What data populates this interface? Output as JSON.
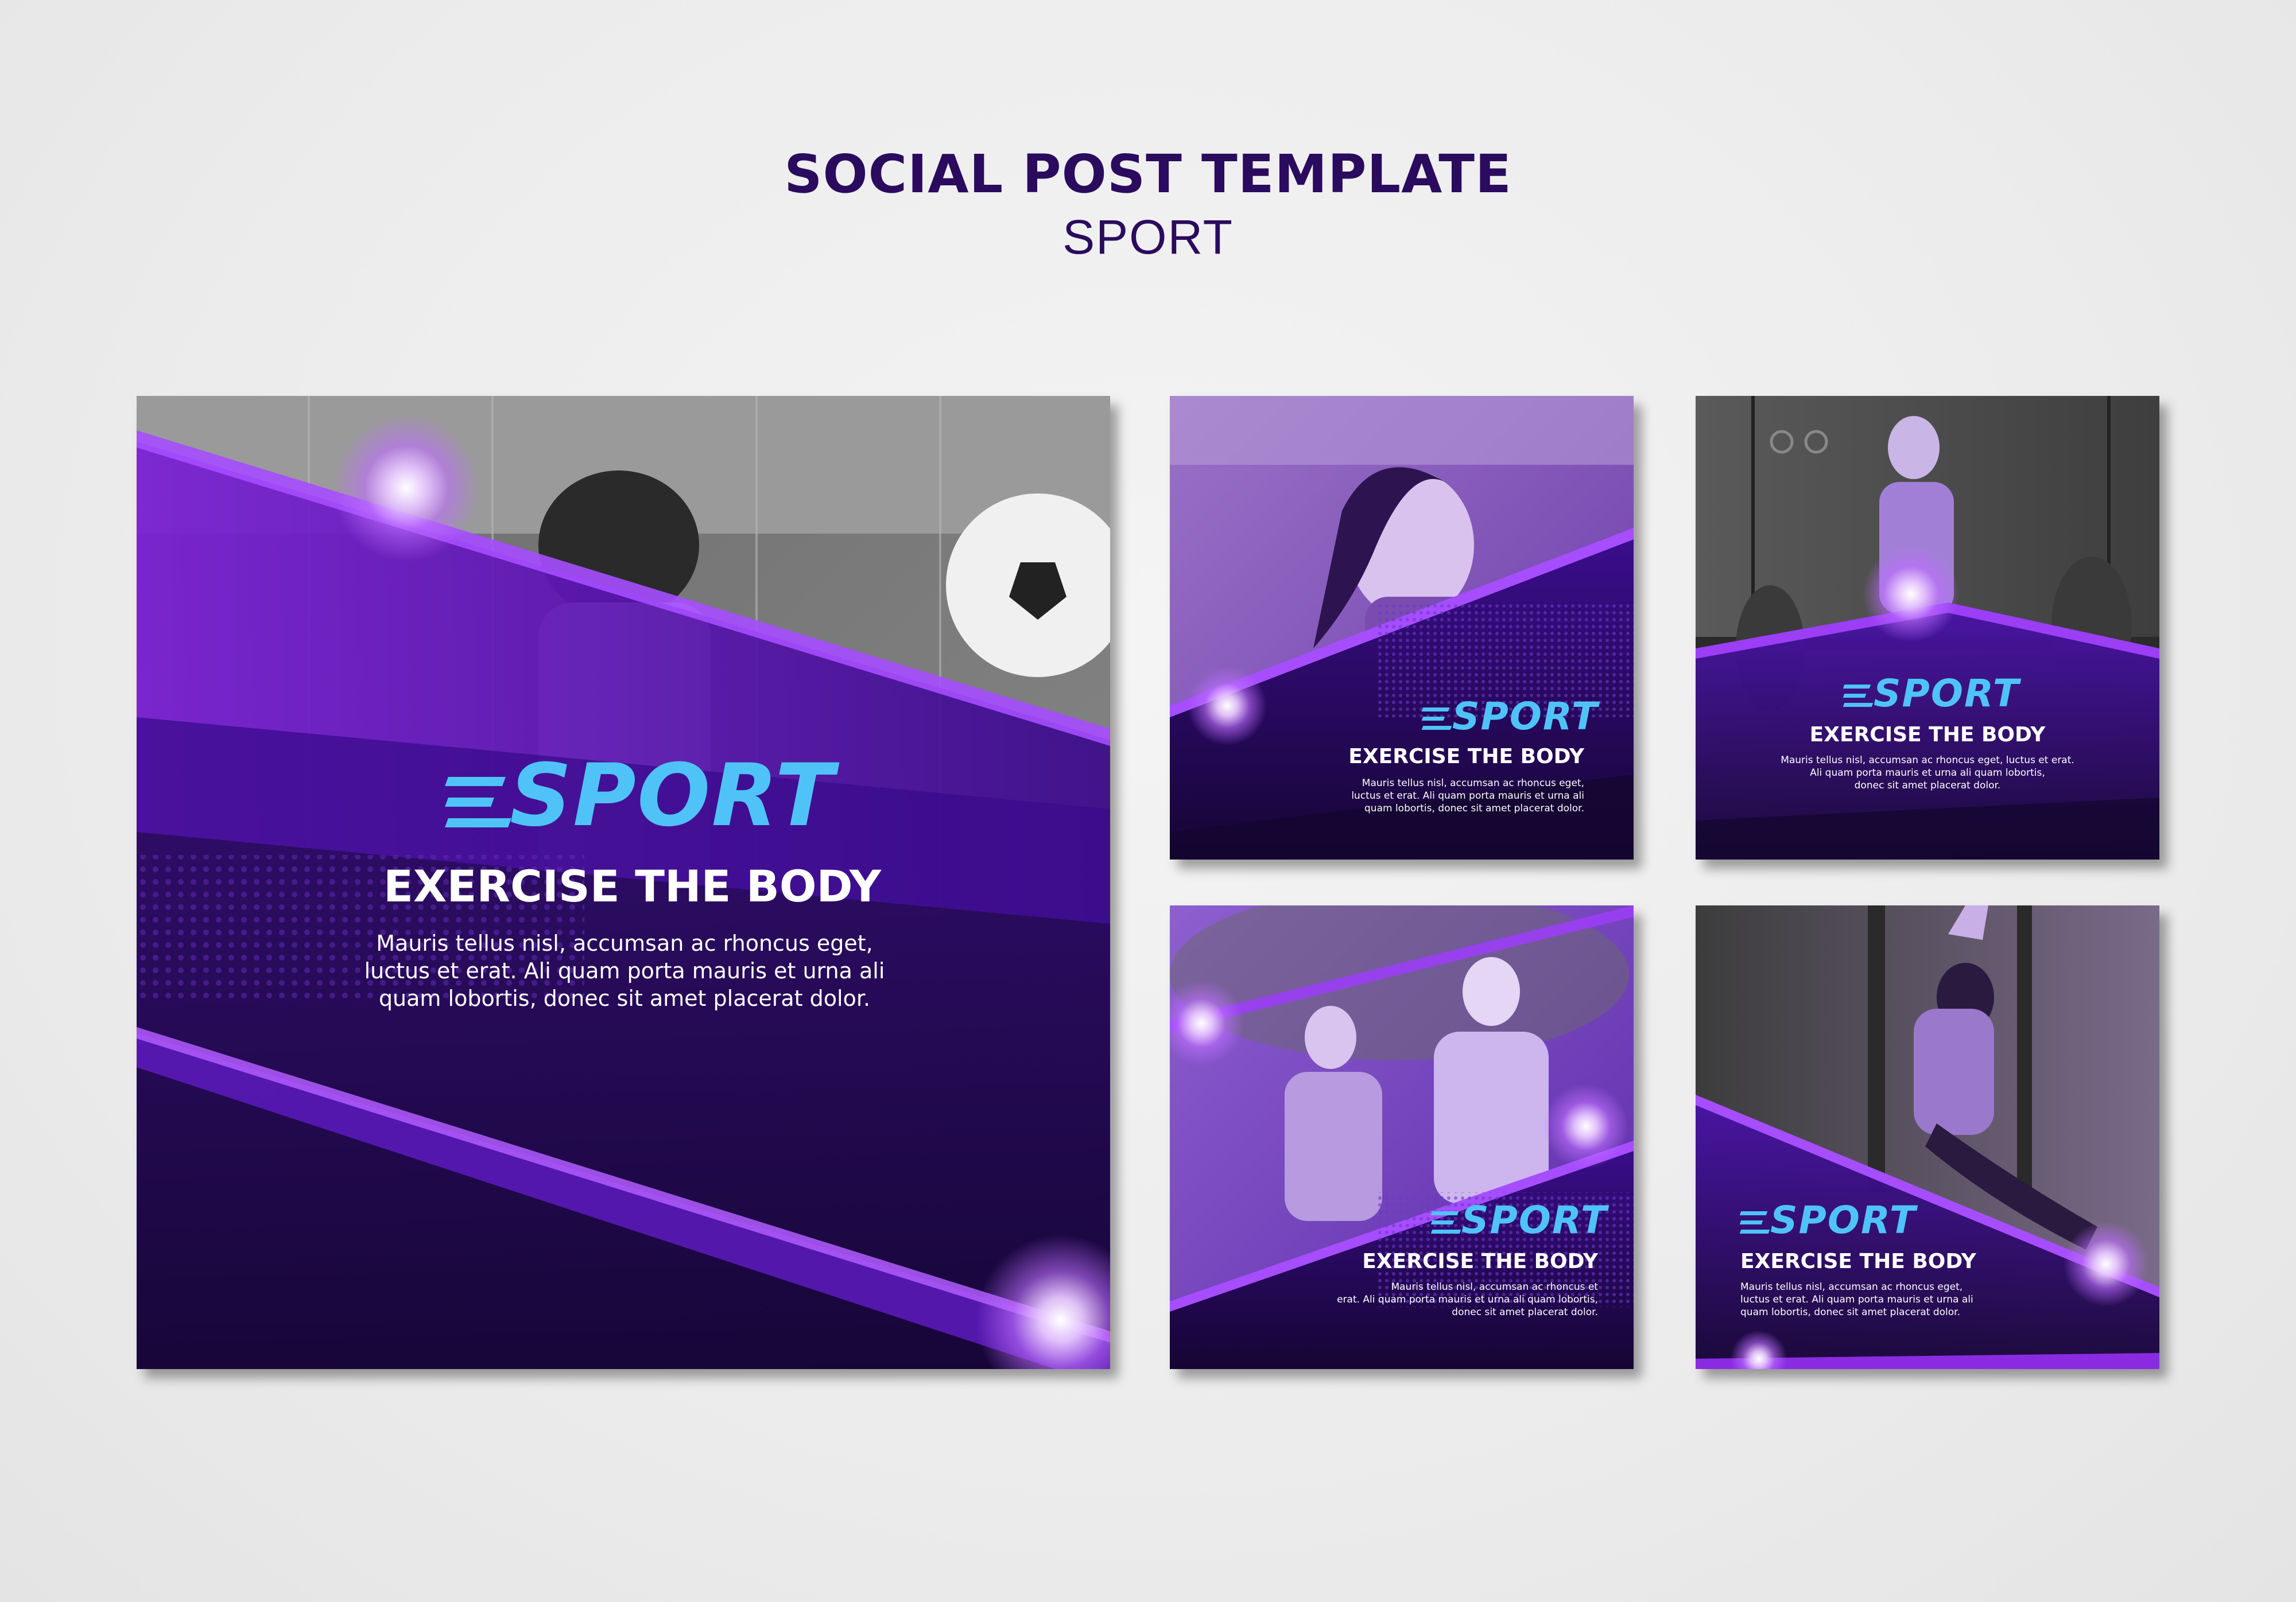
{
  "header": {
    "title": "SOCIAL POST TEMPLATE",
    "subtitle": "SPORT"
  },
  "posts": [
    {
      "logo": "SPORT",
      "headline": "EXERCISE THE BODY",
      "body_lines": [
        "Mauris tellus nisl, accumsan ac rhoncus eget,",
        "luctus et erat. Ali quam porta mauris et urna ali",
        "quam lobortis, donec sit amet placerat dolor."
      ],
      "photo": "soccer-player-photo"
    },
    {
      "logo": "SPORT",
      "headline": "EXERCISE THE BODY",
      "body_lines": [
        "Mauris tellus nisl, accumsan ac rhoncus eget,",
        "luctus et erat. Ali quam porta mauris et urna ali",
        "quam lobortis, donec sit amet placerat dolor."
      ],
      "photo": "runner-woman-photo"
    },
    {
      "logo": "SPORT",
      "headline": "EXERCISE THE BODY",
      "body_lines": [
        "Mauris tellus nisl, accumsan ac rhoncus eget, luctus et erat.",
        "Ali quam porta mauris et urna ali quam lobortis,",
        "donec sit amet placerat dolor."
      ],
      "photo": "weightlifter-photo"
    },
    {
      "logo": "SPORT",
      "headline": "EXERCISE THE BODY",
      "body_lines": [
        "Mauris tellus nisl, accumsan ac rhoncus et",
        "erat. Ali quam porta mauris et urna ali quam lobortis,",
        "donec sit amet placerat dolor."
      ],
      "photo": "stretching-couple-photo"
    },
    {
      "logo": "SPORT",
      "headline": "EXERCISE THE BODY",
      "body_lines": [
        "Mauris tellus nisl, accumsan ac rhoncus eget,",
        "luctus et erat. Ali quam porta mauris et urna ali",
        "quam lobortis, donec sit amet placerat dolor."
      ],
      "photo": "gym-woman-photo"
    }
  ],
  "colors": {
    "background": "#eeeeee",
    "title": "#2a0b5e",
    "accent_purple": "#8a2be2",
    "logo_blue": "#4fc3f7",
    "dark_purple": "#1a0638"
  }
}
